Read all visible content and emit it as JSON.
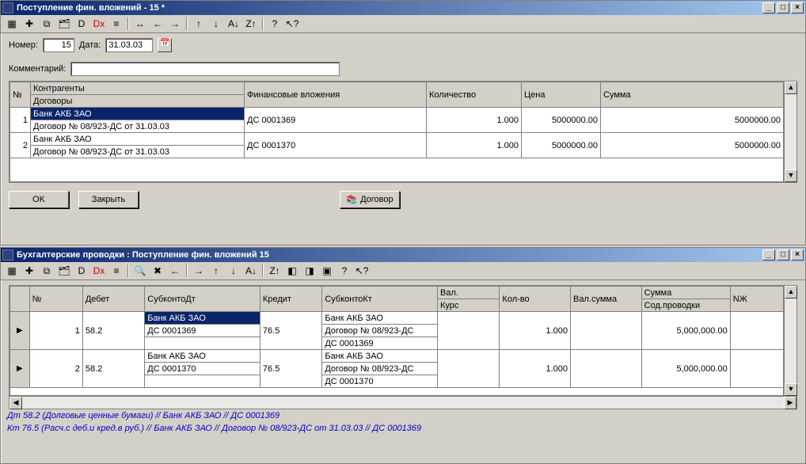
{
  "window1": {
    "title": "Поступление фин. вложений - 15 *",
    "number_label": "Номер:",
    "number_value": "15",
    "date_label": "Дата:",
    "date_value": "31.03.03",
    "comment_label": "Комментарий:",
    "comment_value": "",
    "headers": {
      "num": "№",
      "party": "Контрагенты",
      "contract": "Договоры",
      "fin": "Финансовые вложения",
      "qty": "Количество",
      "price": "Цена",
      "sum": "Сумма"
    },
    "rows": [
      {
        "n": "1",
        "party": "Банк АКБ ЗАО",
        "contract": "Договор № 08/923-ДС от 31.03.03",
        "fin": "ДС 0001369",
        "qty": "1.000",
        "price": "5000000.00",
        "sum": "5000000.00",
        "sel": true
      },
      {
        "n": "2",
        "party": "Банк АКБ ЗАО",
        "contract": "Договор № 08/923-ДС от 31.03.03",
        "fin": "ДС 0001370",
        "qty": "1.000",
        "price": "5000000.00",
        "sum": "5000000.00",
        "sel": false
      }
    ],
    "buttons": {
      "ok": "OK",
      "close": "Закрыть",
      "contract": "Договор"
    }
  },
  "window2": {
    "title": "Бухгалтерские проводки  : Поступление фин. вложений 15",
    "headers": {
      "num": "№",
      "debit": "Дебет",
      "subdt": "СубконтоДт",
      "credit": "Кредит",
      "subkt": "СубконтоКт",
      "val": "Вал.",
      "kurs": "Курс",
      "qty": "Кол-во",
      "valsum": "Вал.сумма",
      "sum": "Сумма",
      "desc": "Сод.проводки",
      "nj": "NЖ"
    },
    "rows": [
      {
        "n": "1",
        "debit": "58.2",
        "subdt": [
          "Банк АКБ ЗАО",
          "ДС 0001369"
        ],
        "credit": "76.5",
        "subkt": [
          "Банк АКБ ЗАО",
          "Договор № 08/923-ДС",
          "ДС 0001369"
        ],
        "val": "",
        "kurs": "",
        "qty": "1.000",
        "valsum": "",
        "sum": "5,000,000.00",
        "sel": true
      },
      {
        "n": "2",
        "debit": "58.2",
        "subdt": [
          "Банк АКБ ЗАО",
          "ДС 0001370"
        ],
        "credit": "76.5",
        "subkt": [
          "Банк АКБ ЗАО",
          "Договор № 08/923-ДС",
          "ДС 0001370"
        ],
        "val": "",
        "kurs": "",
        "qty": "1.000",
        "valsum": "",
        "sum": "5,000,000.00",
        "sel": false
      }
    ],
    "status1": "Дт 58.2 (Долговые ценные бумаги) // Банк АКБ ЗАО // ДС 0001369",
    "status2": "Кт 76.5 (Расч.с деб.и кред.в руб.) // Банк АКБ ЗАО // Договор № 08/923-ДС от 31.03.03 // ДС 0001369"
  },
  "toolbar_icons": [
    "grid-icon",
    "new-icon",
    "copy-icon",
    "cards-icon",
    "doc-d-icon",
    "dx-red-icon",
    "text-icon",
    "range-icon",
    "left-icon",
    "right-icon",
    "up-icon",
    "down-icon",
    "sort-asc-icon",
    "sort-desc-icon",
    "help-icon",
    "arrow-help-icon"
  ],
  "toolbar2_icons": [
    "grid-icon",
    "new-icon",
    "copy-icon",
    "cards-icon",
    "doc-d-icon",
    "dx-red-icon",
    "text-icon",
    "find-icon",
    "cross-icon",
    "left-icon",
    "right-icon",
    "up-icon",
    "down-icon",
    "sort-asc-icon",
    "sort-desc-icon",
    "misc1-icon",
    "misc2-icon",
    "misc3-icon",
    "help-icon",
    "arrow-help-icon"
  ]
}
